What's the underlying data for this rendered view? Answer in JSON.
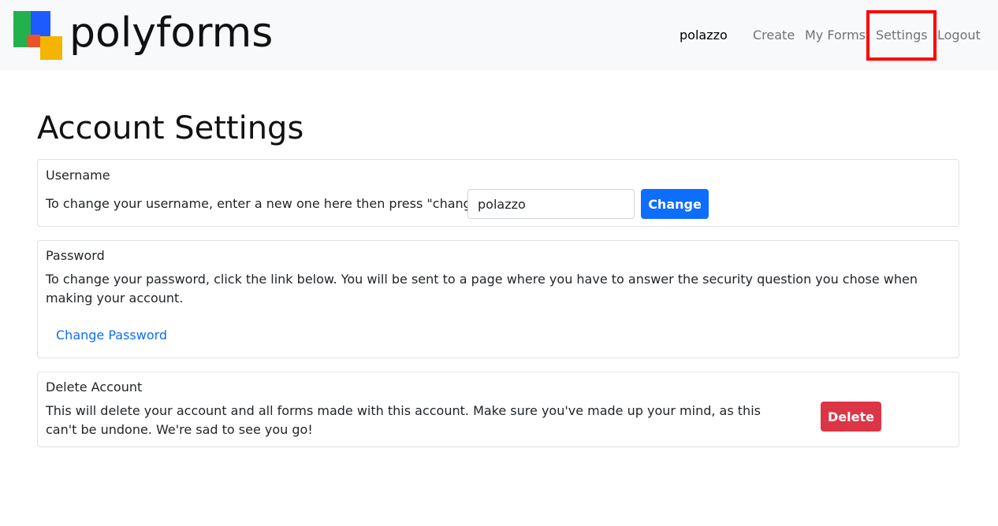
{
  "brand": {
    "name": "polyforms",
    "logo_icon": "polyforms-logo-icon",
    "logo_colors": [
      "#22b14c",
      "#1e5bff",
      "#f4b400",
      "#e9542d"
    ]
  },
  "nav": {
    "username": "polazzo",
    "items": [
      {
        "label": "Create"
      },
      {
        "label": "My Forms"
      },
      {
        "label": "Settings"
      },
      {
        "label": "Logout"
      }
    ],
    "highlight_color": "#ff0000"
  },
  "page": {
    "title": "Account Settings"
  },
  "username_section": {
    "heading": "Username",
    "description": "To change your username, enter a new one here then press \"change\"",
    "input_value": "polazzo",
    "button_label": "Change"
  },
  "password_section": {
    "heading": "Password",
    "description": "To change your password, click the link below. You will be sent to a page where you have to answer the security question you chose when making your account.",
    "link_label": "Change Password"
  },
  "delete_section": {
    "heading": "Delete Account",
    "description": "This will delete your account and all forms made with this account. Make sure you've made up your mind, as this can't be undone. We're sad to see you go!",
    "button_label": "Delete"
  },
  "colors": {
    "primary": "#0d6efd",
    "danger": "#dc3545",
    "navbar_bg": "#f8f9fa"
  }
}
